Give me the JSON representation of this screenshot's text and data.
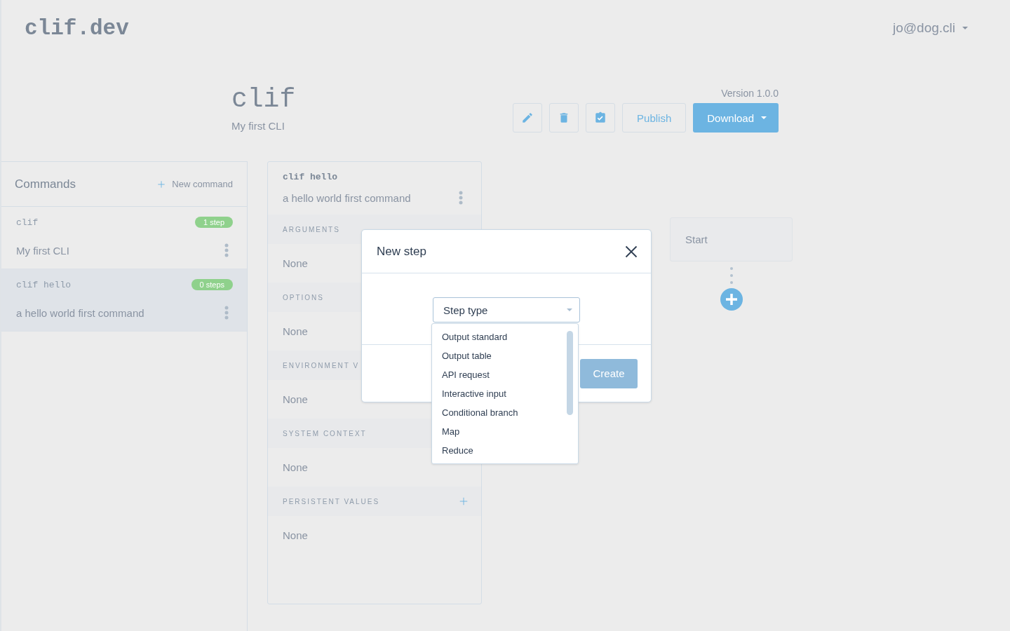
{
  "header": {
    "logo": "clif.dev",
    "user": "jo@dog.cli"
  },
  "project": {
    "name": "clif",
    "description": "My first CLI",
    "version": "Version 1.0.0",
    "actions": [
      {
        "kind": "edit"
      },
      {
        "kind": "delete"
      },
      {
        "kind": "validate"
      }
    ],
    "publish": "Publish",
    "download": "Download"
  },
  "commands": {
    "title": "Commands",
    "new_label": "New command",
    "items": [
      {
        "name": "clif",
        "badge": "1 step",
        "description": "My first CLI",
        "selected": false
      },
      {
        "name": "clif hello",
        "badge": "0 steps",
        "description": "a hello world first command",
        "selected": true
      }
    ]
  },
  "command_detail": {
    "name": "clif hello",
    "description": "a hello world first command",
    "sections": [
      {
        "title": "ARGUMENTS",
        "value": "None"
      },
      {
        "title": "OPTIONS",
        "value": "None"
      },
      {
        "title": "ENVIRONMENT V",
        "value": "None"
      },
      {
        "title": "SYSTEM CONTEXT",
        "value": "None"
      },
      {
        "title": "PERSISTENT VALUES",
        "value": "None",
        "addable": true
      }
    ]
  },
  "flow": {
    "start": "Start"
  },
  "modal": {
    "title": "New step",
    "select_placeholder": "Step type",
    "options": [
      "Output standard",
      "Output table",
      "API request",
      "Interactive input",
      "Conditional branch",
      "Map",
      "Reduce"
    ],
    "create": "Create",
    "create_disabled": true
  }
}
